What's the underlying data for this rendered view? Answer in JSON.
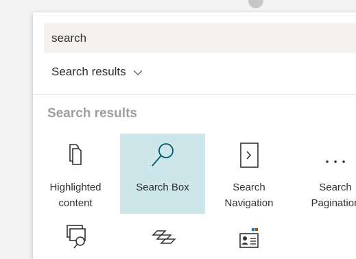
{
  "search": {
    "value": "search"
  },
  "filter": {
    "label": "Search results"
  },
  "section": {
    "title": "Search results"
  },
  "tiles": [
    {
      "line1": "Highlighted",
      "line2": "content",
      "icon": "highlighted-content-icon"
    },
    {
      "line1": "Search Box",
      "line2": "",
      "icon": "search-box-icon"
    },
    {
      "line1": "Search",
      "line2": "Navigation",
      "icon": "search-navigation-icon"
    },
    {
      "line1": "Search",
      "line2": "Pagination",
      "icon": "search-pagination-icon"
    }
  ],
  "colors": {
    "selected": "#cce6ea",
    "accent": "#005b70",
    "title": "#a19f9d"
  }
}
